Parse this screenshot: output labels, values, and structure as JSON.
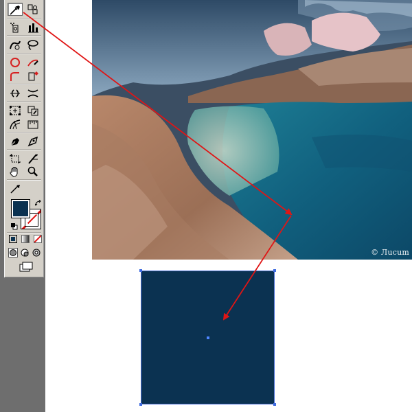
{
  "toolbar": {
    "tools": [
      {
        "id": "eyedropper",
        "icon": "eyedropper-icon",
        "active": true
      },
      {
        "id": "live-paint",
        "icon": "live-paint-bucket-icon"
      },
      {
        "id": "symbol-sprayer",
        "icon": "symbol-sprayer-icon"
      },
      {
        "id": "column-graph",
        "icon": "column-graph-icon"
      },
      {
        "id": "warp",
        "icon": "warp-icon"
      },
      {
        "id": "lasso",
        "icon": "lasso-icon"
      },
      {
        "id": "ellipse",
        "icon": "ellipse-icon"
      },
      {
        "id": "pencil",
        "icon": "pencil-icon"
      },
      {
        "id": "rounded-rect",
        "icon": "rounded-rectangle-icon"
      },
      {
        "id": "paint-bucket",
        "icon": "paint-bucket-icon"
      },
      {
        "id": "reflect",
        "icon": "reflect-icon"
      },
      {
        "id": "scissors",
        "icon": "scissors-icon"
      },
      {
        "id": "free-transform",
        "icon": "free-transform-icon"
      },
      {
        "id": "shape-builder",
        "icon": "shape-builder-icon"
      },
      {
        "id": "mesh",
        "icon": "mesh-icon"
      },
      {
        "id": "measure",
        "icon": "measure-icon"
      },
      {
        "id": "pen",
        "icon": "pen-icon"
      },
      {
        "id": "blend",
        "icon": "blend-icon"
      },
      {
        "id": "crop",
        "icon": "crop-icon"
      },
      {
        "id": "slice",
        "icon": "slice-icon"
      },
      {
        "id": "hand",
        "icon": "hand-icon"
      },
      {
        "id": "zoom",
        "icon": "zoom-icon"
      },
      {
        "id": "eyedropper-2",
        "icon": "eyedropper-icon"
      }
    ]
  },
  "colors": {
    "fill": "#0b3251",
    "stroke_none_line": "#e01515",
    "sample": "#0b3251",
    "arrow": "#e01515",
    "selection": "#3e6be0"
  },
  "photo": {
    "credit": "© Лucum"
  }
}
